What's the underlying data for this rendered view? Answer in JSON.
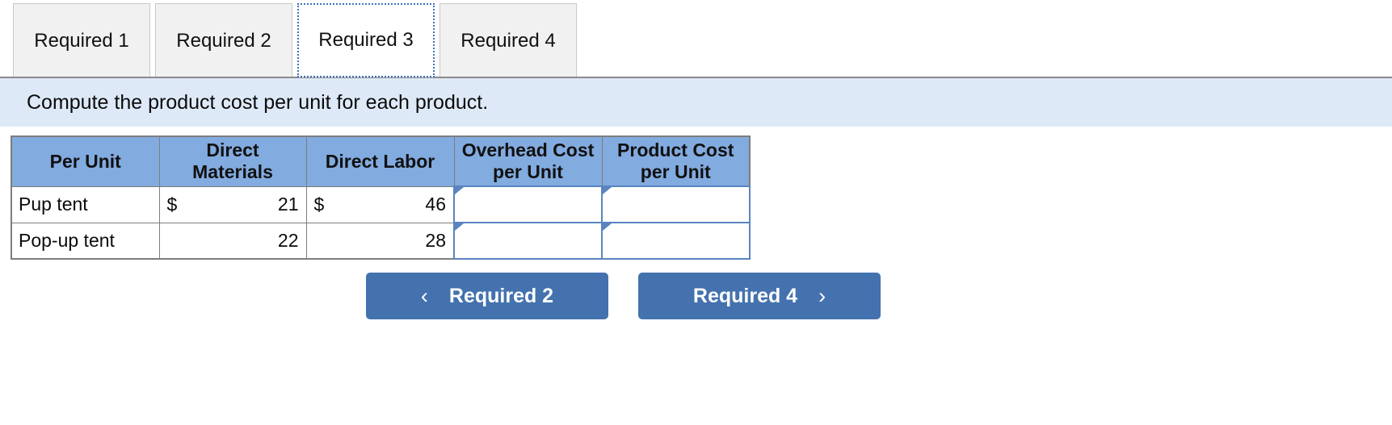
{
  "tabs": {
    "items": [
      {
        "label": "Required 1",
        "active": false
      },
      {
        "label": "Required 2",
        "active": false
      },
      {
        "label": "Required 3",
        "active": true
      },
      {
        "label": "Required 4",
        "active": false
      }
    ]
  },
  "instruction": {
    "text": "Compute the product cost per unit for each product."
  },
  "table": {
    "headers": [
      "Per Unit",
      "Direct Materials",
      "Direct Labor",
      "Overhead Cost per Unit",
      "Product Cost per Unit"
    ],
    "rows": [
      {
        "label": "Pup tent",
        "direct_materials_currency": "$",
        "direct_materials": "21",
        "direct_labor_currency": "$",
        "direct_labor": "46",
        "overhead_cost_per_unit": "",
        "product_cost_per_unit": ""
      },
      {
        "label": "Pop-up tent",
        "direct_materials_currency": "",
        "direct_materials": "22",
        "direct_labor_currency": "",
        "direct_labor": "28",
        "overhead_cost_per_unit": "",
        "product_cost_per_unit": ""
      }
    ]
  },
  "nav": {
    "prev_label": "Required 2",
    "next_label": "Required 4",
    "prev_icon": "chevron-left-icon",
    "next_icon": "chevron-right-icon",
    "prev_glyph": "‹",
    "next_glyph": "›"
  },
  "colors": {
    "header_blue": "#82abdf",
    "instruction_blue": "#dee9f7",
    "button_blue": "#4472ae",
    "input_border_blue": "#5a84c0",
    "tab_inactive": "#f1f1f1",
    "grid_gray": "#7d7d7d"
  }
}
